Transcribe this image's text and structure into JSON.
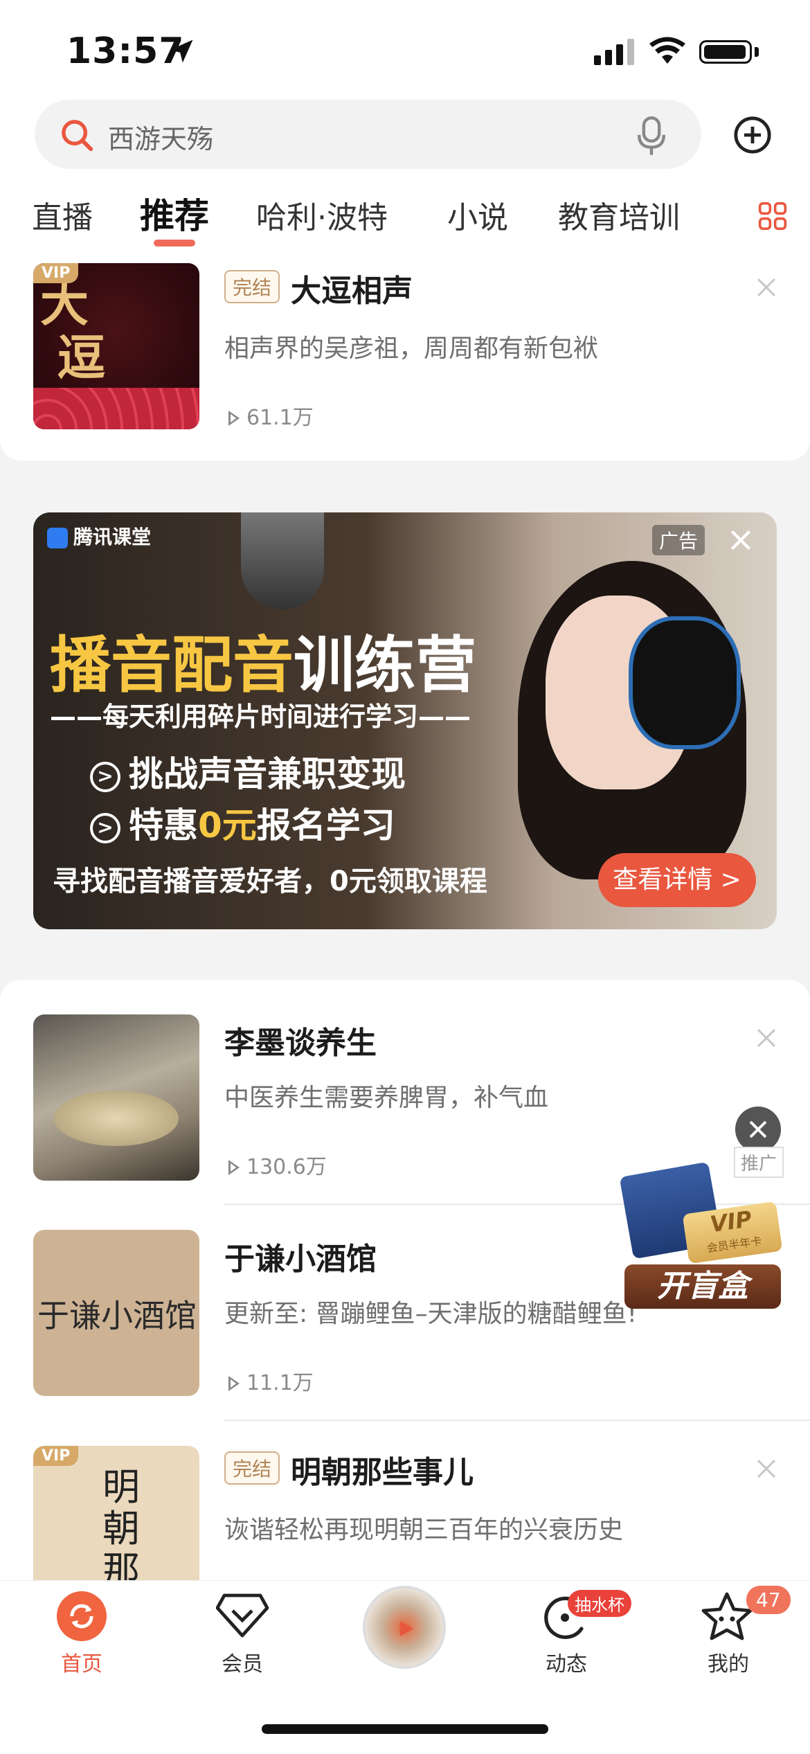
{
  "status_bar": {
    "time": "13:57"
  },
  "search": {
    "placeholder": "西游天殇"
  },
  "tabs": [
    {
      "label": "直播"
    },
    {
      "label": "推荐",
      "active": true
    },
    {
      "label": "哈利·波特"
    },
    {
      "label": "小说"
    },
    {
      "label": "教育培训"
    }
  ],
  "items": [
    {
      "cover_text": "大逗相声",
      "vip": "VIP",
      "badge": "完结",
      "title": "大逗相声",
      "desc": "相声界的吴彦祖，周周都有新包袱",
      "plays": "61.1万"
    },
    {
      "title": "李墨谈养生",
      "desc": "中医养生需要养脾胃，补气血",
      "plays": "130.6万"
    },
    {
      "cover_text": "于谦小酒馆",
      "title": "于谦小酒馆",
      "desc": "更新至: 罾蹦鲤鱼–天津版的糖醋鲤鱼!",
      "plays": "11.1万"
    },
    {
      "cover_text": "明朝那些事儿",
      "vip": "VIP",
      "badge": "完结",
      "title": "明朝那些事儿",
      "desc": "诙谐轻松再现明朝三百年的兴衰历史"
    }
  ],
  "ad": {
    "brand": "腾讯课堂",
    "tag": "广告",
    "headline_yellow": "播音配音",
    "headline_white": "训练营",
    "subline": "——每天利用碎片时间进行学习——",
    "bullet1": "挑战声音兼职变现",
    "bullet2_pre": "特惠",
    "bullet2_hl": "0元",
    "bullet2_post": "报名学习",
    "bottom_text": "寻找配音播音爱好者，0元领取课程",
    "cta": "查看详情 >"
  },
  "promo": {
    "tag": "推广",
    "button": "开盲盒",
    "card_text": "VIP",
    "card_sub": "会员半年卡"
  },
  "tabbar": {
    "home": "首页",
    "vip": "会员",
    "feed": "动态",
    "feed_badge": "抽水杯",
    "me": "我的",
    "me_badge": "47"
  },
  "colors": {
    "accent": "#e9573f",
    "ad_yellow": "#f7c743",
    "vip_gold": "#d6a969"
  }
}
